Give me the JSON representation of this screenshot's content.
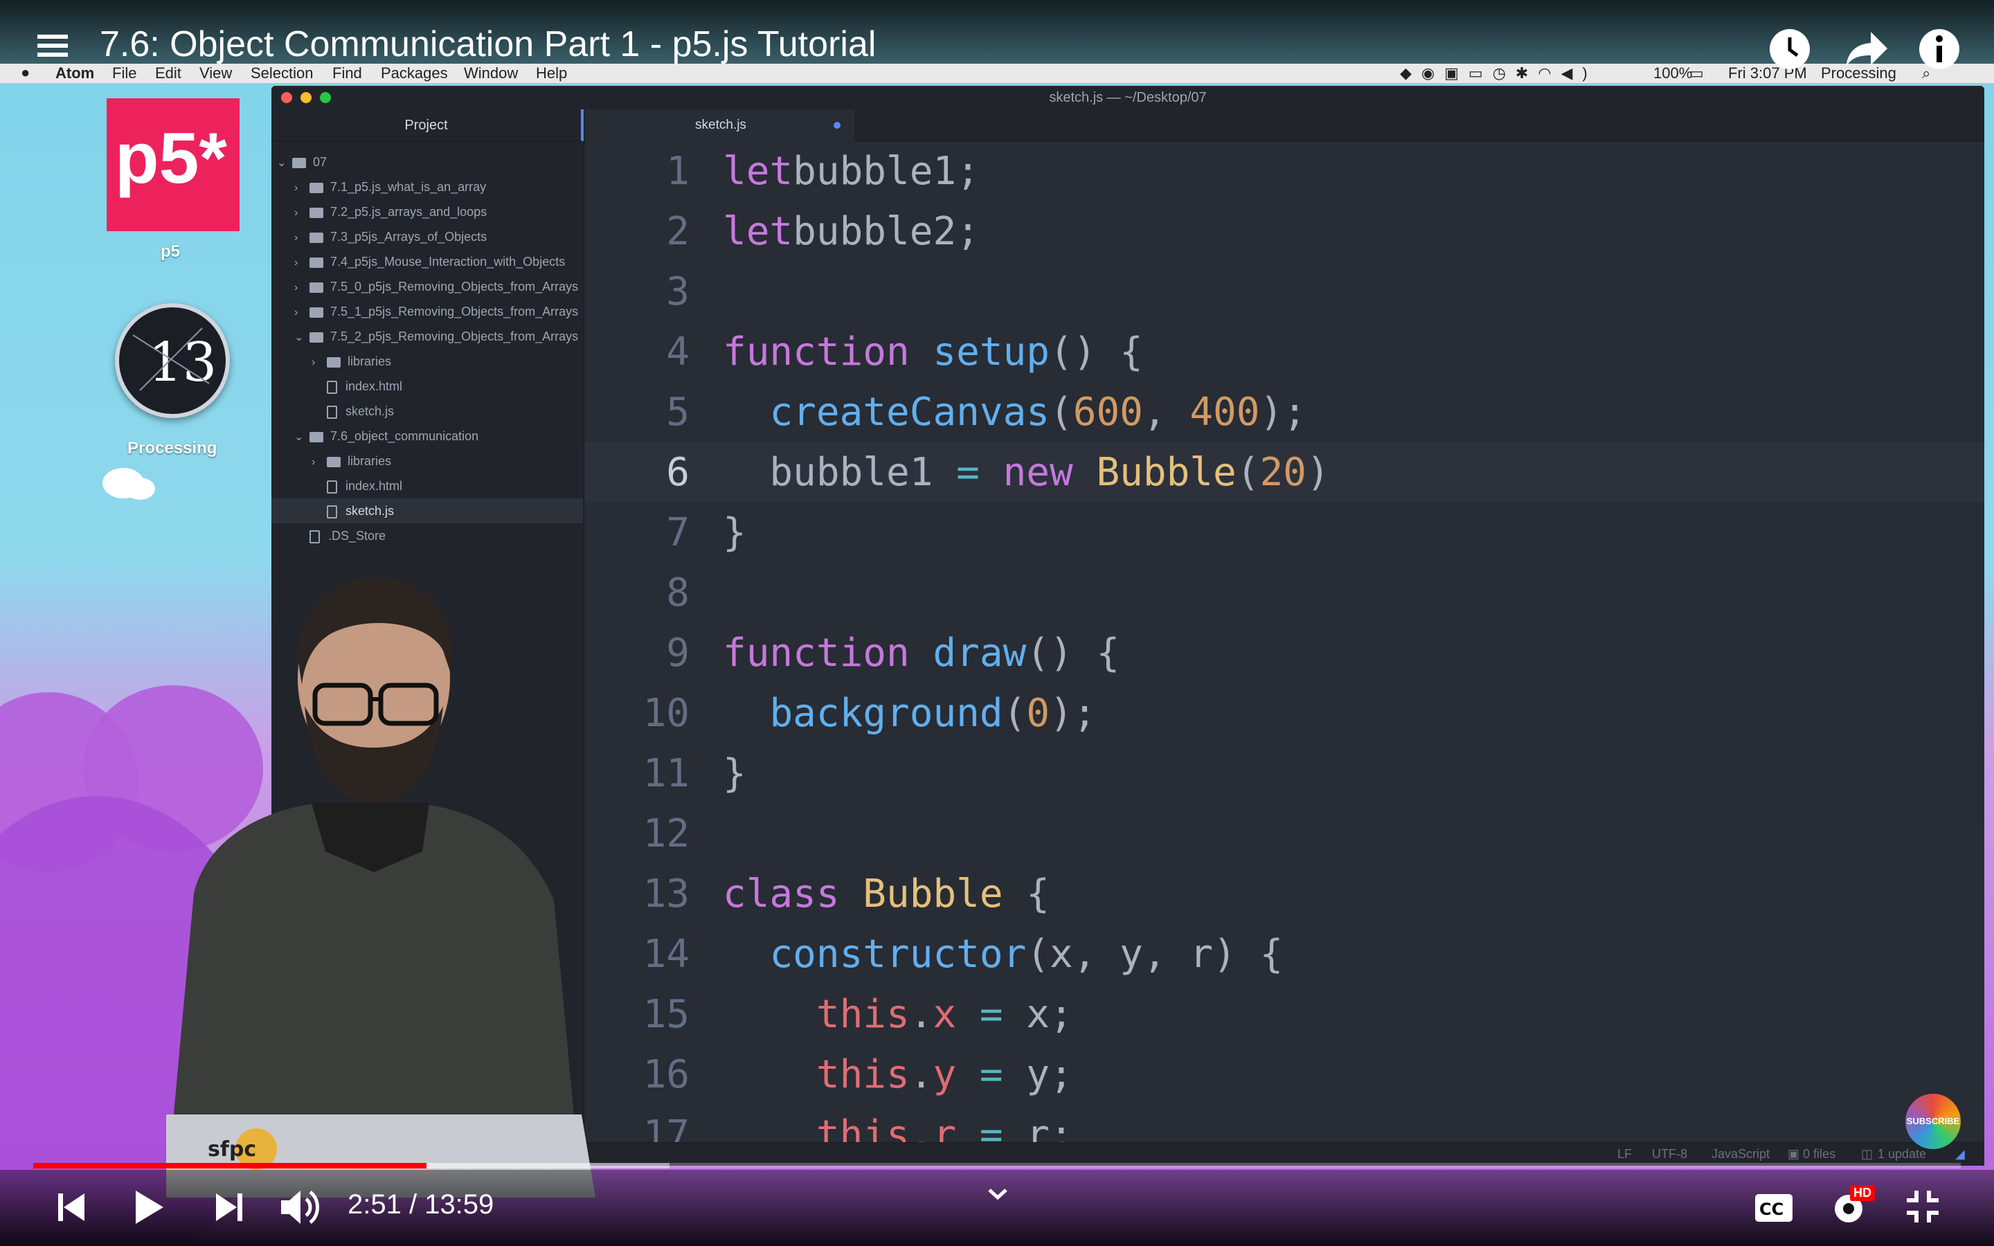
{
  "video": {
    "title": "7.6: Object Communication Part 1 - p5.js Tutorial",
    "time": "2:51 / 13:59",
    "progress": 0.204,
    "buffered": 0.33,
    "subscribe_label": "SUBSCRIBE",
    "hd_badge": "HD"
  },
  "menubar": {
    "app": "Atom",
    "items": [
      "File",
      "Edit",
      "View",
      "Selection",
      "Find",
      "Packages",
      "Window",
      "Help"
    ],
    "battery": "100%",
    "clock": "Fri 3:07 PM",
    "user": "Processing"
  },
  "desktop": {
    "icon1_label": "p5",
    "icon2_label": "Processing",
    "p5_logo_text": "p5*"
  },
  "atom": {
    "window_title": "sketch.js — ~/Desktop/07",
    "tree_title": "Project",
    "tree": [
      {
        "label": "07",
        "type": "folder",
        "open": true,
        "depth": 0
      },
      {
        "label": "7.1_p5.js_what_is_an_array",
        "type": "folder",
        "open": false,
        "depth": 1
      },
      {
        "label": "7.2_p5.js_arrays_and_loops",
        "type": "folder",
        "open": false,
        "depth": 1
      },
      {
        "label": "7.3_p5js_Arrays_of_Objects",
        "type": "folder",
        "open": false,
        "depth": 1
      },
      {
        "label": "7.4_p5js_Mouse_Interaction_with_Objects",
        "type": "folder",
        "open": false,
        "depth": 1
      },
      {
        "label": "7.5_0_p5js_Removing_Objects_from_Arrays",
        "type": "folder",
        "open": false,
        "depth": 1
      },
      {
        "label": "7.5_1_p5js_Removing_Objects_from_Arrays",
        "type": "folder",
        "open": false,
        "depth": 1
      },
      {
        "label": "7.5_2_p5js_Removing_Objects_from_Arrays",
        "type": "folder",
        "open": true,
        "depth": 1
      },
      {
        "label": "libraries",
        "type": "folder",
        "open": false,
        "depth": 2
      },
      {
        "label": "index.html",
        "type": "file",
        "depth": 2
      },
      {
        "label": "sketch.js",
        "type": "file",
        "depth": 2
      },
      {
        "label": "7.6_object_communication",
        "type": "folder",
        "open": true,
        "depth": 1
      },
      {
        "label": "libraries",
        "type": "folder",
        "open": false,
        "depth": 2
      },
      {
        "label": "index.html",
        "type": "file",
        "depth": 2
      },
      {
        "label": "sketch.js",
        "type": "file",
        "depth": 2,
        "selected": true
      },
      {
        "label": ".DS_Store",
        "type": "file",
        "depth": 1
      }
    ],
    "tab_label": "sketch.js",
    "current_line": 6,
    "code": [
      [
        [
          "kw",
          "let"
        ],
        [
          "",
          "bubble1;"
        ]
      ],
      [
        [
          "kw",
          "let"
        ],
        [
          "",
          "bubble2;"
        ]
      ],
      [],
      [
        [
          "kw",
          "function"
        ],
        [
          "fn",
          "setup"
        ],
        [
          "",
          "() {"
        ]
      ],
      [
        [
          "",
          "  "
        ],
        [
          "fn",
          "createCanvas"
        ],
        [
          "",
          "("
        ],
        [
          "num",
          "600"
        ],
        [
          "",
          ", "
        ],
        [
          "num",
          "400"
        ],
        [
          "",
          ");"
        ]
      ],
      [
        [
          "",
          "  bubble1 "
        ],
        [
          "op",
          "="
        ],
        [
          "kw",
          " new"
        ],
        [
          "cls",
          " Bubble"
        ],
        [
          "",
          "("
        ],
        [
          "num",
          "20"
        ],
        [
          "",
          ")"
        ]
      ],
      [
        [
          "",
          "}"
        ]
      ],
      [],
      [
        [
          "kw",
          "function"
        ],
        [
          "fn",
          "draw"
        ],
        [
          "",
          "() {"
        ]
      ],
      [
        [
          "",
          "  "
        ],
        [
          "fn",
          "background"
        ],
        [
          "",
          "("
        ],
        [
          "num",
          "0"
        ],
        [
          "",
          ");"
        ]
      ],
      [
        [
          "",
          "}"
        ]
      ],
      [],
      [
        [
          "kw",
          "class"
        ],
        [
          "cls",
          "Bubble"
        ],
        [
          "",
          " {"
        ]
      ],
      [
        [
          "",
          "  "
        ],
        [
          "fn",
          "constructor"
        ],
        [
          "",
          "(x, y, r) {"
        ]
      ],
      [
        [
          "",
          "    "
        ],
        [
          "pr",
          "this"
        ],
        [
          "",
          "."
        ],
        [
          "pr",
          "x"
        ],
        [
          "",
          " "
        ],
        [
          "op",
          "="
        ],
        [
          "",
          " x;"
        ]
      ],
      [
        [
          "",
          "    "
        ],
        [
          "pr",
          "this"
        ],
        [
          "",
          "."
        ],
        [
          "pr",
          "y"
        ],
        [
          "",
          " "
        ],
        [
          "op",
          "="
        ],
        [
          "",
          " y;"
        ]
      ],
      [
        [
          "",
          "    "
        ],
        [
          "pr",
          "this"
        ],
        [
          "",
          "."
        ],
        [
          "pr",
          "r"
        ],
        [
          "",
          " "
        ],
        [
          "op",
          "="
        ],
        [
          "",
          " r;"
        ]
      ]
    ],
    "status": {
      "eol": "LF",
      "encoding": "UTF-8",
      "grammar": "JavaScript",
      "files": "0 files",
      "updates": "1 update"
    }
  },
  "colors": {
    "progress": "#ff0000",
    "editor_bg": "#282c34",
    "p5_red": "#ed225d"
  }
}
